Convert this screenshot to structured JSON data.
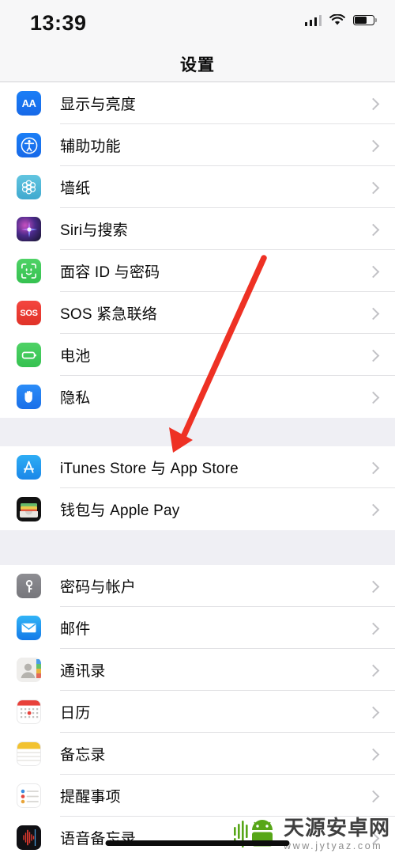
{
  "status_bar": {
    "time": "13:39",
    "signal_icon": "cellular-signal-icon",
    "wifi_icon": "wifi-icon",
    "battery_icon": "battery-icon",
    "battery_level_percent": 65
  },
  "nav": {
    "title": "设置"
  },
  "groups": [
    {
      "id": "group-system",
      "rows": [
        {
          "label": "显示与亮度",
          "icon": "display-brightness-icon",
          "icon_text": "AA",
          "chevron": "chevron-right-icon"
        },
        {
          "label": "辅助功能",
          "icon": "accessibility-icon",
          "chevron": "chevron-right-icon"
        },
        {
          "label": "墙纸",
          "icon": "wallpaper-icon",
          "chevron": "chevron-right-icon"
        },
        {
          "label": "Siri与搜索",
          "icon": "siri-icon",
          "chevron": "chevron-right-icon"
        },
        {
          "label": "面容 ID 与密码",
          "icon": "face-id-icon",
          "chevron": "chevron-right-icon"
        },
        {
          "label": "SOS 紧急联络",
          "icon": "sos-icon",
          "icon_text": "SOS",
          "chevron": "chevron-right-icon"
        },
        {
          "label": "电池",
          "icon": "battery-settings-icon",
          "chevron": "chevron-right-icon"
        },
        {
          "label": "隐私",
          "icon": "privacy-hand-icon",
          "chevron": "chevron-right-icon"
        }
      ]
    },
    {
      "id": "group-store",
      "rows": [
        {
          "label": "iTunes Store 与 App Store",
          "icon": "app-store-icon",
          "chevron": "chevron-right-icon"
        },
        {
          "label": "钱包与 Apple Pay",
          "icon": "wallet-icon",
          "chevron": "chevron-right-icon"
        }
      ]
    },
    {
      "id": "group-apps",
      "rows": [
        {
          "label": "密码与帐户",
          "icon": "passwords-key-icon",
          "chevron": "chevron-right-icon"
        },
        {
          "label": "邮件",
          "icon": "mail-icon",
          "chevron": "chevron-right-icon"
        },
        {
          "label": "通讯录",
          "icon": "contacts-icon",
          "chevron": "chevron-right-icon"
        },
        {
          "label": "日历",
          "icon": "calendar-icon",
          "chevron": "chevron-right-icon"
        },
        {
          "label": "备忘录",
          "icon": "notes-icon",
          "chevron": "chevron-right-icon"
        },
        {
          "label": "提醒事项",
          "icon": "reminders-icon",
          "chevron": "chevron-right-icon"
        },
        {
          "label": "语音备忘录",
          "icon": "voice-memos-icon",
          "chevron": "chevron-right-icon"
        }
      ]
    }
  ],
  "annotation": {
    "arrow_icon": "red-arrow-annotation",
    "color": "#ee3124",
    "points_to": "iTunes Store 与 App Store"
  },
  "watermark": {
    "logo_icon": "android-robot-logo",
    "site_name": "天源安卓网",
    "url": "www.jytyaz.com",
    "logo_color": "#57a618"
  },
  "home_indicator": {
    "icon": "home-indicator-bar"
  }
}
